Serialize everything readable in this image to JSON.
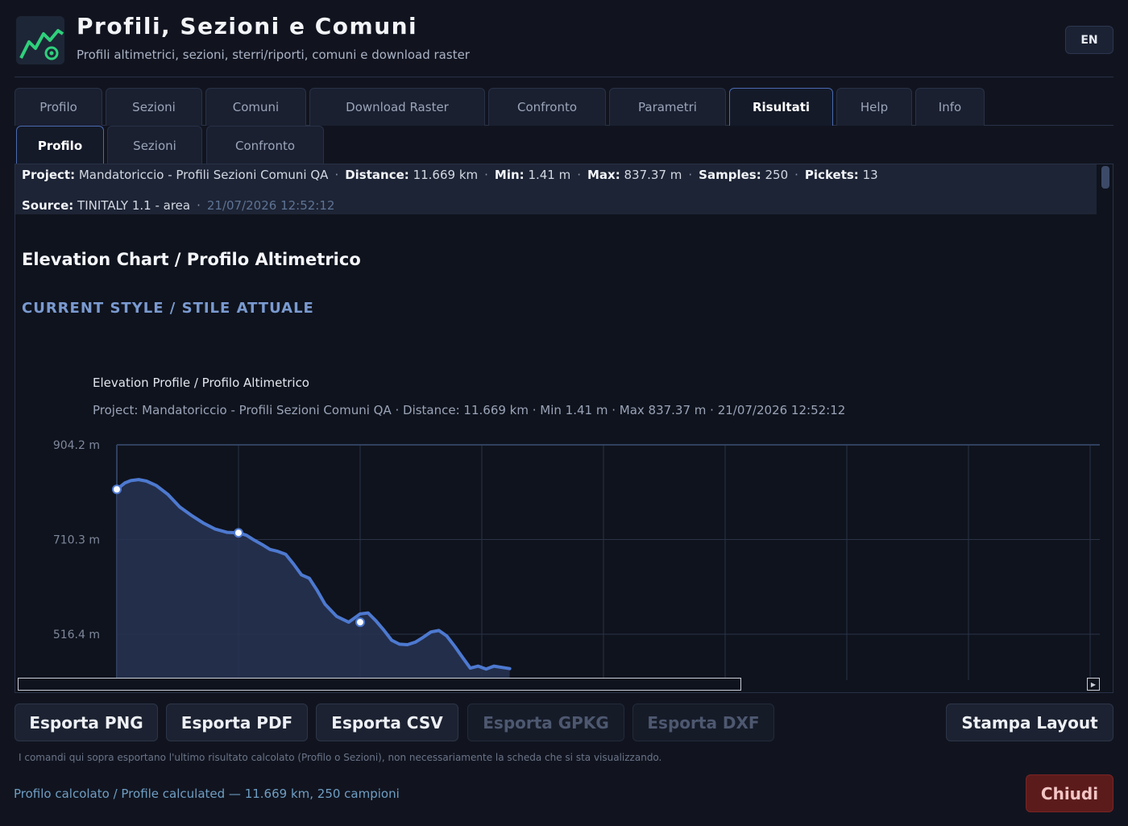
{
  "header": {
    "title": "Profili, Sezioni e Comuni",
    "subtitle": "Profili altimetrici, sezioni, sterri/riporti, comuni e download raster",
    "lang_button": "EN"
  },
  "tabs": [
    {
      "label": "Profilo"
    },
    {
      "label": "Sezioni"
    },
    {
      "label": "Comuni"
    },
    {
      "label": "Download Raster"
    },
    {
      "label": "Confronto"
    },
    {
      "label": "Parametri"
    },
    {
      "label": "Risultati",
      "active": true
    },
    {
      "label": "Help"
    },
    {
      "label": "Info"
    }
  ],
  "subtabs": [
    {
      "label": "Profilo",
      "active": true
    },
    {
      "label": "Sezioni"
    },
    {
      "label": "Confronto"
    }
  ],
  "info": {
    "project_label": "Project:",
    "project": "Mandatoriccio - Profili Sezioni Comuni QA",
    "distance_label": "Distance:",
    "distance": "11.669 km",
    "min_label": "Min:",
    "min": "1.41 m",
    "max_label": "Max:",
    "max": "837.37 m",
    "samples_label": "Samples:",
    "samples": "250",
    "pickets_label": "Pickets:",
    "pickets": "13",
    "source_label": "Source:",
    "source": "TINITALY 1.1 - area",
    "timestamp": "21/07/2026 12:52:12",
    "sep": "·"
  },
  "section": {
    "heading": "Elevation Chart / Profilo Altimetrico",
    "style_heading": "CURRENT STYLE / STILE ATTUALE"
  },
  "chart_data": {
    "type": "area",
    "title": "Elevation Profile / Profilo Altimetrico",
    "subtitle": "Project: Mandatoriccio - Profili Sezioni Comuni QA · Distance: 11.669 km · Min 1.41 m · Max 837.37 m · 21/07/2026 12:52:12",
    "y_tick_labels": [
      "904.2 m",
      "710.3 m",
      "516.4 m"
    ],
    "y_ticks": [
      904.2,
      710.3,
      516.4
    ],
    "x": [
      0.0,
      0.13,
      0.23,
      0.36,
      0.49,
      0.65,
      0.84,
      1.04,
      1.23,
      1.43,
      1.62,
      1.82,
      2.01,
      2.14,
      2.27,
      2.4,
      2.53,
      2.66,
      2.79,
      2.92,
      3.05,
      3.18,
      3.31,
      3.44,
      3.63,
      3.83,
      4.02,
      4.15,
      4.28,
      4.41,
      4.54,
      4.67,
      4.8,
      4.93,
      5.06,
      5.19,
      5.32,
      5.45,
      5.58,
      5.71,
      5.84,
      5.97,
      6.1,
      6.23,
      6.49
    ],
    "y": [
      813,
      826,
      831,
      833,
      830,
      821,
      803,
      777,
      760,
      744,
      732,
      725,
      724,
      719,
      709,
      700,
      690,
      686,
      680,
      660,
      638,
      631,
      606,
      578,
      553,
      541,
      558,
      560,
      544,
      525,
      504,
      496,
      495,
      500,
      510,
      521,
      524,
      513,
      492,
      469,
      447,
      451,
      445,
      451,
      446
    ],
    "pickets": [
      {
        "x": 0.0,
        "y": 813
      },
      {
        "x": 2.01,
        "y": 724
      },
      {
        "x": 4.02,
        "y": 541
      }
    ],
    "ylim": [
      380,
      904.2
    ],
    "grid": true,
    "colors": {
      "line": "#4d79d0",
      "fill": "#273452",
      "grid": "#2a3347",
      "axis": "#30405f",
      "marker": "#ffffff"
    }
  },
  "buttons": {
    "png": "Esporta PNG",
    "pdf": "Esporta PDF",
    "csv": "Esporta CSV",
    "gpkg": "Esporta GPKG",
    "dxf": "Esporta DXF",
    "print": "Stampa Layout",
    "close": "Chiudi"
  },
  "note": "I comandi qui sopra esportano l'ultimo risultato calcolato (Profilo o Sezioni), non necessariamente la scheda che si sta visualizzando.",
  "status": "Profilo calcolato / Profile calculated — 11.669 km, 250 campioni"
}
